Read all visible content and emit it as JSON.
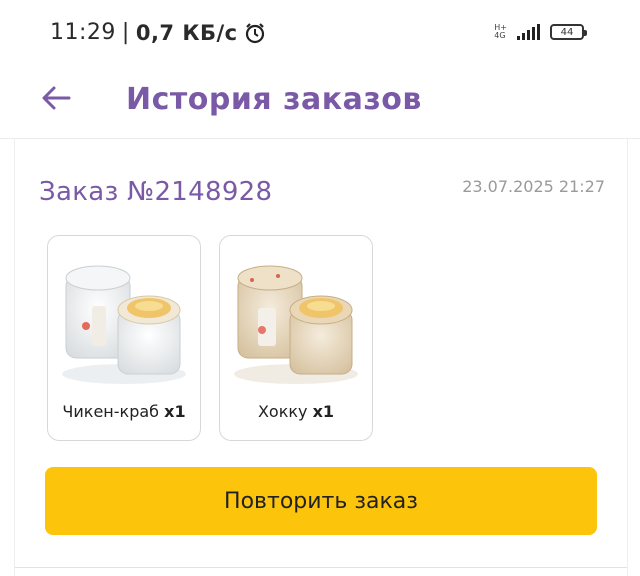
{
  "status_bar": {
    "time": "11:29",
    "separator": "|",
    "speed": "0,7 КБ/с",
    "network_type_top": "H+",
    "network_type_bottom": "4G",
    "battery": "44"
  },
  "header": {
    "title": "История заказов"
  },
  "order": {
    "title": "Заказ №2148928",
    "date": "23.07.2025 21:27",
    "items": [
      {
        "name": "Чикен-краб",
        "qty": "x1"
      },
      {
        "name": "Хокку",
        "qty": "x1"
      }
    ],
    "repeat_label": "Повторить заказ"
  },
  "colors": {
    "accent": "#7a5aa6",
    "button": "#fcc40b"
  }
}
